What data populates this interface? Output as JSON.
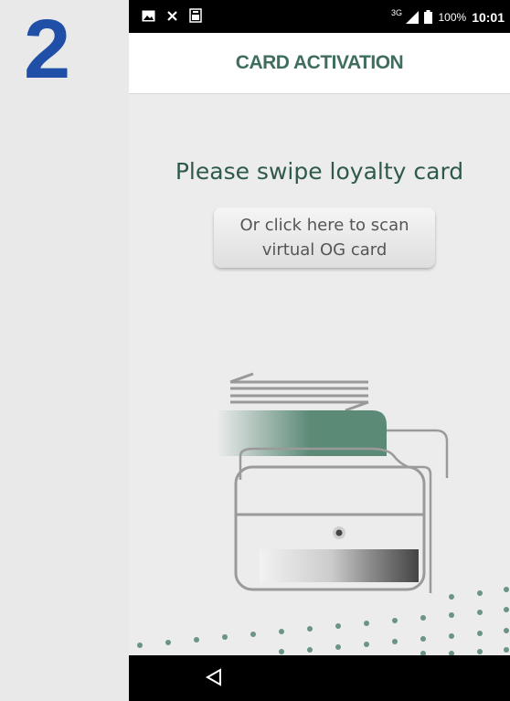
{
  "step": {
    "number": "2"
  },
  "status_bar": {
    "left_icons": [
      "image-icon",
      "mute-icon",
      "sim-icon"
    ],
    "signal_label": "3G",
    "battery_text": "100%",
    "time": "10:01"
  },
  "header": {
    "title": "CARD ACTIVATION"
  },
  "main": {
    "instruction": "Please swipe loyalty card",
    "scan_button": {
      "line1": "Or click here to scan",
      "line2": "virtual OG card"
    }
  },
  "colors": {
    "accent": "#3f6e5d",
    "step_number": "#1f4fa6",
    "card_green": "#5b8a77"
  },
  "nav_bar": {
    "icons": [
      "back-icon"
    ]
  }
}
